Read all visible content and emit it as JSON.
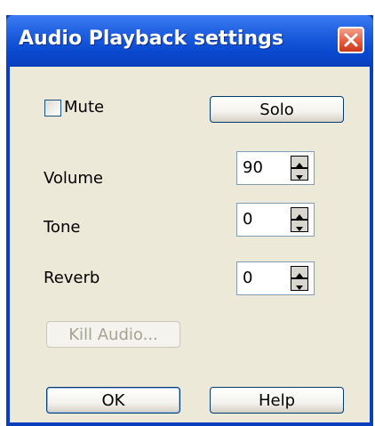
{
  "window": {
    "title": "Audio Playback settings"
  },
  "mute": {
    "label": "Mute",
    "checked": false
  },
  "solo_button": "Solo",
  "fields": [
    {
      "label": "Volume",
      "value": "90"
    },
    {
      "label": "Tone",
      "value": "0"
    },
    {
      "label": "Reverb",
      "value": "0"
    }
  ],
  "kill_audio_button": "Kill Audio...",
  "ok_button": "OK",
  "help_button": "Help",
  "colors": {
    "titlebar": "#0a4ad0",
    "dialog_bg": "#ece9d8",
    "close_button": "#e2583c"
  }
}
